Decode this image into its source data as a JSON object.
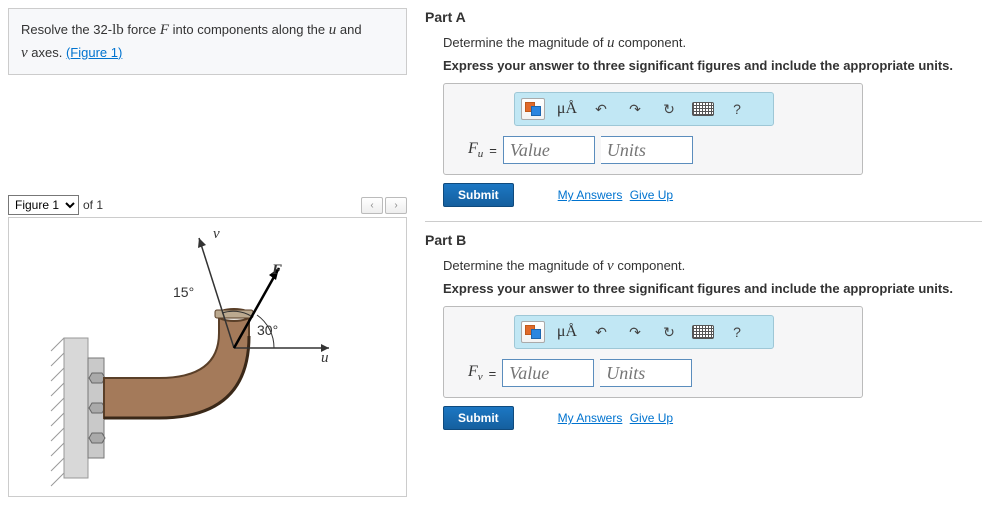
{
  "problem": {
    "text_prefix": "Resolve the 32-",
    "unit": "lb",
    "text_mid": " force ",
    "force_sym": "F",
    "text_after_force": " into components along the ",
    "var_u": "u",
    "and": " and ",
    "var_v": "v",
    "text_end": " axes. ",
    "figure_link": "(Figure 1)"
  },
  "figure_bar": {
    "select_label": "Figure 1",
    "of_text": "of 1",
    "prev": "‹",
    "next": "›"
  },
  "figure_labels": {
    "v": "v",
    "F": "F",
    "u": "u",
    "angle1": "15°",
    "angle2": "30°"
  },
  "partA": {
    "title": "Part A",
    "instr": "Determine the magnitude of u component.",
    "instr_bold": "Express your answer to three significant figures and include the appropriate units.",
    "symbol": "F",
    "sub": "u",
    "eq": " = ",
    "value_placeholder": "Value",
    "units_placeholder": "Units",
    "submit": "Submit",
    "my_answers": "My Answers",
    "give_up": "Give Up"
  },
  "partB": {
    "title": "Part B",
    "instr": "Determine the magnitude of v component.",
    "instr_bold": "Express your answer to three significant figures and include the appropriate units.",
    "symbol": "F",
    "sub": "v",
    "eq": " = ",
    "value_placeholder": "Value",
    "units_placeholder": "Units",
    "submit": "Submit",
    "my_answers": "My Answers",
    "give_up": "Give Up"
  },
  "toolbar": {
    "mu_label": "μÅ",
    "undo": "↶",
    "redo": "↷",
    "reset": "↻",
    "help": "?"
  }
}
